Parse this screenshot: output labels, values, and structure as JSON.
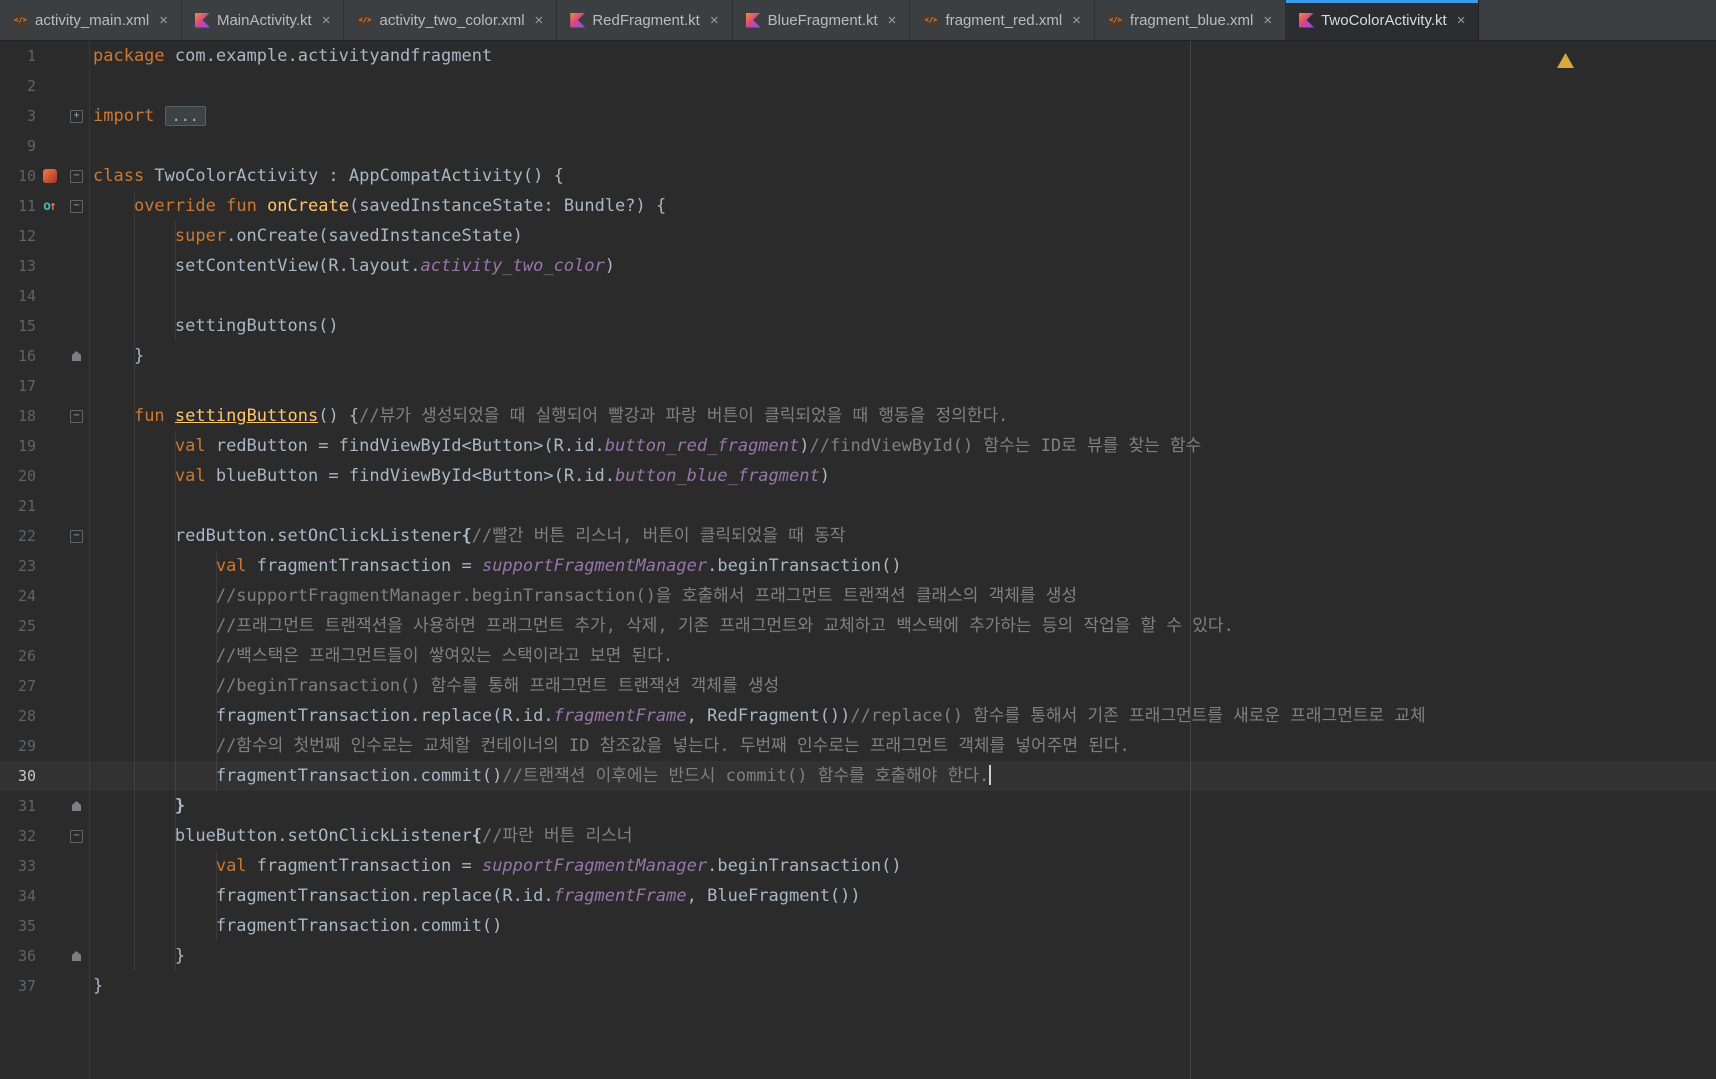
{
  "tabs": [
    {
      "label": "activity_main.xml",
      "icon": "xml",
      "close": "×",
      "active": false
    },
    {
      "label": "MainActivity.kt",
      "icon": "kt",
      "close": "×",
      "active": false
    },
    {
      "label": "activity_two_color.xml",
      "icon": "xml",
      "close": "×",
      "active": false
    },
    {
      "label": "RedFragment.kt",
      "icon": "kt",
      "close": "×",
      "active": false
    },
    {
      "label": "BlueFragment.kt",
      "icon": "kt",
      "close": "×",
      "active": false
    },
    {
      "label": "fragment_red.xml",
      "icon": "xml",
      "close": "×",
      "active": false
    },
    {
      "label": "fragment_blue.xml",
      "icon": "xml",
      "close": "×",
      "active": false
    },
    {
      "label": "TwoColorActivity.kt",
      "icon": "kt",
      "close": "×",
      "active": true
    }
  ],
  "colors": {
    "editor_background": "#2B2B2B",
    "tab_bar_background": "#3C3F41",
    "active_tab_indicator": "#3D9AE6",
    "keyword": "#CC7832",
    "function_declaration": "#FFC66D",
    "comment": "#808080",
    "identifier": "#A9B7C6",
    "instance_member": "#9876AA",
    "line_number": "#606366",
    "current_line_background": "#323232",
    "warning_indicator": "#D9A93E"
  },
  "editor": {
    "folded_placeholder": "...",
    "lines": [
      {
        "n": "1",
        "segs": [
          [
            "kw",
            "package"
          ],
          [
            "pl",
            " com.example.activityandfragment"
          ]
        ]
      },
      {
        "n": "2",
        "segs": []
      },
      {
        "n": "3",
        "segs": [
          [
            "kw",
            "import"
          ],
          [
            "pl",
            " "
          ],
          [
            "fold",
            "..."
          ]
        ],
        "fold": "plus"
      },
      {
        "n": "9",
        "segs": []
      },
      {
        "n": "10",
        "segs": [
          [
            "kw",
            "class"
          ],
          [
            "pl",
            " TwoColorActivity : AppCompatActivity() {"
          ]
        ],
        "mark": "class",
        "fold": "minus"
      },
      {
        "n": "11",
        "segs": [
          [
            "pl",
            "    "
          ],
          [
            "kw",
            "override"
          ],
          [
            "pl",
            " "
          ],
          [
            "kw",
            "fun"
          ],
          [
            "pl",
            " "
          ],
          [
            "fn",
            "onCreate"
          ],
          [
            "pl",
            "(savedInstanceState: Bundle?) {"
          ]
        ],
        "mark": "override",
        "fold": "minus"
      },
      {
        "n": "12",
        "segs": [
          [
            "pl",
            "        "
          ],
          [
            "kw",
            "super"
          ],
          [
            "pl",
            ".onCreate(savedInstanceState)"
          ]
        ]
      },
      {
        "n": "13",
        "segs": [
          [
            "pl",
            "        setContentView(R.layout."
          ],
          [
            "pr",
            "activity_two_color"
          ],
          [
            "pl",
            ")"
          ]
        ]
      },
      {
        "n": "14",
        "segs": []
      },
      {
        "n": "15",
        "segs": [
          [
            "pl",
            "        settingButtons()"
          ]
        ]
      },
      {
        "n": "16",
        "segs": [
          [
            "pl",
            "    }"
          ]
        ],
        "fold": "end"
      },
      {
        "n": "17",
        "segs": []
      },
      {
        "n": "18",
        "segs": [
          [
            "pl",
            "    "
          ],
          [
            "kw",
            "fun"
          ],
          [
            "pl",
            " "
          ],
          [
            "fnu",
            "settingButtons"
          ],
          [
            "pl",
            "() {"
          ],
          [
            "cm",
            "//뷰가 생성되었을 때 실행되어 빨강과 파랑 버튼이 클릭되었을 때 행동을 정의한다."
          ]
        ],
        "fold": "minus"
      },
      {
        "n": "19",
        "segs": [
          [
            "pl",
            "        "
          ],
          [
            "kw",
            "val"
          ],
          [
            "pl",
            " redButton = findViewById<Button>(R.id."
          ],
          [
            "pr",
            "button_red_fragment"
          ],
          [
            "pl",
            ")"
          ],
          [
            "cm",
            "//findViewById() 함수는 ID로 뷰를 찾는 함수"
          ]
        ]
      },
      {
        "n": "20",
        "segs": [
          [
            "pl",
            "        "
          ],
          [
            "kw",
            "val"
          ],
          [
            "pl",
            " blueButton = findViewById<Button>(R.id."
          ],
          [
            "pr",
            "button_blue_fragment"
          ],
          [
            "pl",
            ")"
          ]
        ]
      },
      {
        "n": "21",
        "segs": []
      },
      {
        "n": "22",
        "segs": [
          [
            "pl",
            "        redButton.setOnClickListener"
          ],
          [
            "plb",
            "{"
          ],
          [
            "cm",
            "//빨간 버튼 리스너, 버튼이 클릭되었을 때 동작"
          ]
        ],
        "fold": "minus"
      },
      {
        "n": "23",
        "segs": [
          [
            "pl",
            "            "
          ],
          [
            "kw",
            "val"
          ],
          [
            "pl",
            " fragmentTransaction = "
          ],
          [
            "pr",
            "supportFragmentManager"
          ],
          [
            "pl",
            ".beginTransaction()"
          ]
        ]
      },
      {
        "n": "24",
        "segs": [
          [
            "pl",
            "            "
          ],
          [
            "cm",
            "//supportFragmentManager.beginTransaction()을 호출해서 프래그먼트 트랜잭션 클래스의 객체를 생성"
          ]
        ]
      },
      {
        "n": "25",
        "segs": [
          [
            "pl",
            "            "
          ],
          [
            "cm",
            "//프래그먼트 트랜잭션을 사용하면 프래그먼트 추가, 삭제, 기존 프래그먼트와 교체하고 백스택에 추가하는 등의 작업을 할 수 있다."
          ]
        ]
      },
      {
        "n": "26",
        "segs": [
          [
            "pl",
            "            "
          ],
          [
            "cm",
            "//백스택은 프래그먼트들이 쌓여있는 스택이라고 보면 된다."
          ]
        ]
      },
      {
        "n": "27",
        "segs": [
          [
            "pl",
            "            "
          ],
          [
            "cm",
            "//beginTransaction() 함수를 통해 프래그먼트 트랜잭션 객체를 생성"
          ]
        ]
      },
      {
        "n": "28",
        "segs": [
          [
            "pl",
            "            fragmentTransaction.replace(R.id."
          ],
          [
            "pr",
            "fragmentFrame"
          ],
          [
            "pl",
            ", RedFragment())"
          ],
          [
            "cm",
            "//replace() 함수를 통해서 기존 프래그먼트를 새로운 프래그먼트로 교체"
          ]
        ]
      },
      {
        "n": "29",
        "segs": [
          [
            "pl",
            "            "
          ],
          [
            "cm",
            "//함수의 첫번째 인수로는 교체할 컨테이너의 ID 참조값을 넣는다. 두번째 인수로는 프래그먼트 객체를 넣어주면 된다."
          ]
        ]
      },
      {
        "n": "30",
        "segs": [
          [
            "pl",
            "            fragmentTransaction.commit()"
          ],
          [
            "cm",
            "//트랜잭션 이후에는 반드시 commit() 함수를 호출해야 한다."
          ]
        ],
        "cur": true,
        "caret": true
      },
      {
        "n": "31",
        "segs": [
          [
            "pl",
            "        "
          ],
          [
            "plb",
            "}"
          ]
        ],
        "fold": "end"
      },
      {
        "n": "32",
        "segs": [
          [
            "pl",
            "        blueButton.setOnClickListener"
          ],
          [
            "plb",
            "{"
          ],
          [
            "cm",
            "//파란 버튼 리스너"
          ]
        ],
        "fold": "minus"
      },
      {
        "n": "33",
        "segs": [
          [
            "pl",
            "            "
          ],
          [
            "kw",
            "val"
          ],
          [
            "pl",
            " fragmentTransaction = "
          ],
          [
            "pr",
            "supportFragmentManager"
          ],
          [
            "pl",
            ".beginTransaction()"
          ]
        ]
      },
      {
        "n": "34",
        "segs": [
          [
            "pl",
            "            fragmentTransaction.replace(R.id."
          ],
          [
            "pr",
            "fragmentFrame"
          ],
          [
            "pl",
            ", BlueFragment())"
          ]
        ]
      },
      {
        "n": "35",
        "segs": [
          [
            "pl",
            "            fragmentTransaction.commit()"
          ]
        ]
      },
      {
        "n": "36",
        "segs": [
          [
            "pl",
            "        }"
          ]
        ],
        "fold": "end"
      },
      {
        "n": "37",
        "segs": [
          [
            "pl",
            "}"
          ]
        ]
      }
    ]
  }
}
